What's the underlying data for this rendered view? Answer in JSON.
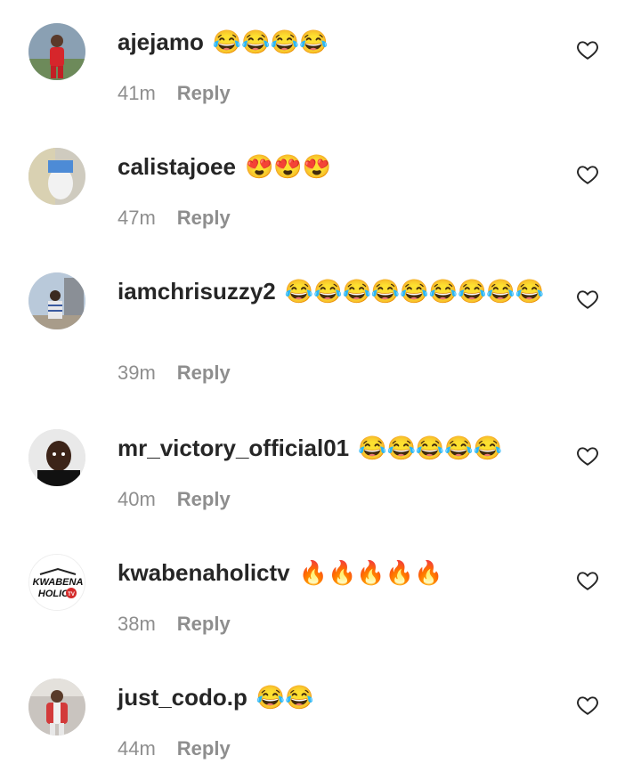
{
  "comments": [
    {
      "username": "ajejamo",
      "text": "😂😂😂😂",
      "time": "41m",
      "reply": "Reply",
      "avatar": "avatar-red-outfit",
      "heart_icon": "heart-outline-icon"
    },
    {
      "username": "calistajoee",
      "text": "😍😍😍",
      "time": "47m",
      "reply": "Reply",
      "avatar": "avatar-white-pants",
      "heart_icon": "heart-outline-icon"
    },
    {
      "username": "iamchrisuzzy2",
      "text": "😂😂😂😂😂😂😂😂😂",
      "time": "39m",
      "reply": "Reply",
      "avatar": "avatar-man-striped-shirt",
      "heart_icon": "heart-outline-icon"
    },
    {
      "username": "mr_victory_official01",
      "text": "😂😂😂😂😂",
      "time": "40m",
      "reply": "Reply",
      "avatar": "avatar-man-selfie",
      "heart_icon": "heart-outline-icon"
    },
    {
      "username": "kwabenaholictv",
      "text": "🔥🔥🔥🔥🔥",
      "time": "38m",
      "reply": "Reply",
      "avatar": "avatar-kwabenaholic-logo",
      "heart_icon": "heart-outline-icon"
    },
    {
      "username": "just_codo.p",
      "text": "😂😂",
      "time": "44m",
      "reply": "Reply",
      "avatar": "avatar-person-red-jacket",
      "heart_icon": "heart-outline-icon"
    }
  ],
  "logo_text": "KWABENA HOLIC TV"
}
